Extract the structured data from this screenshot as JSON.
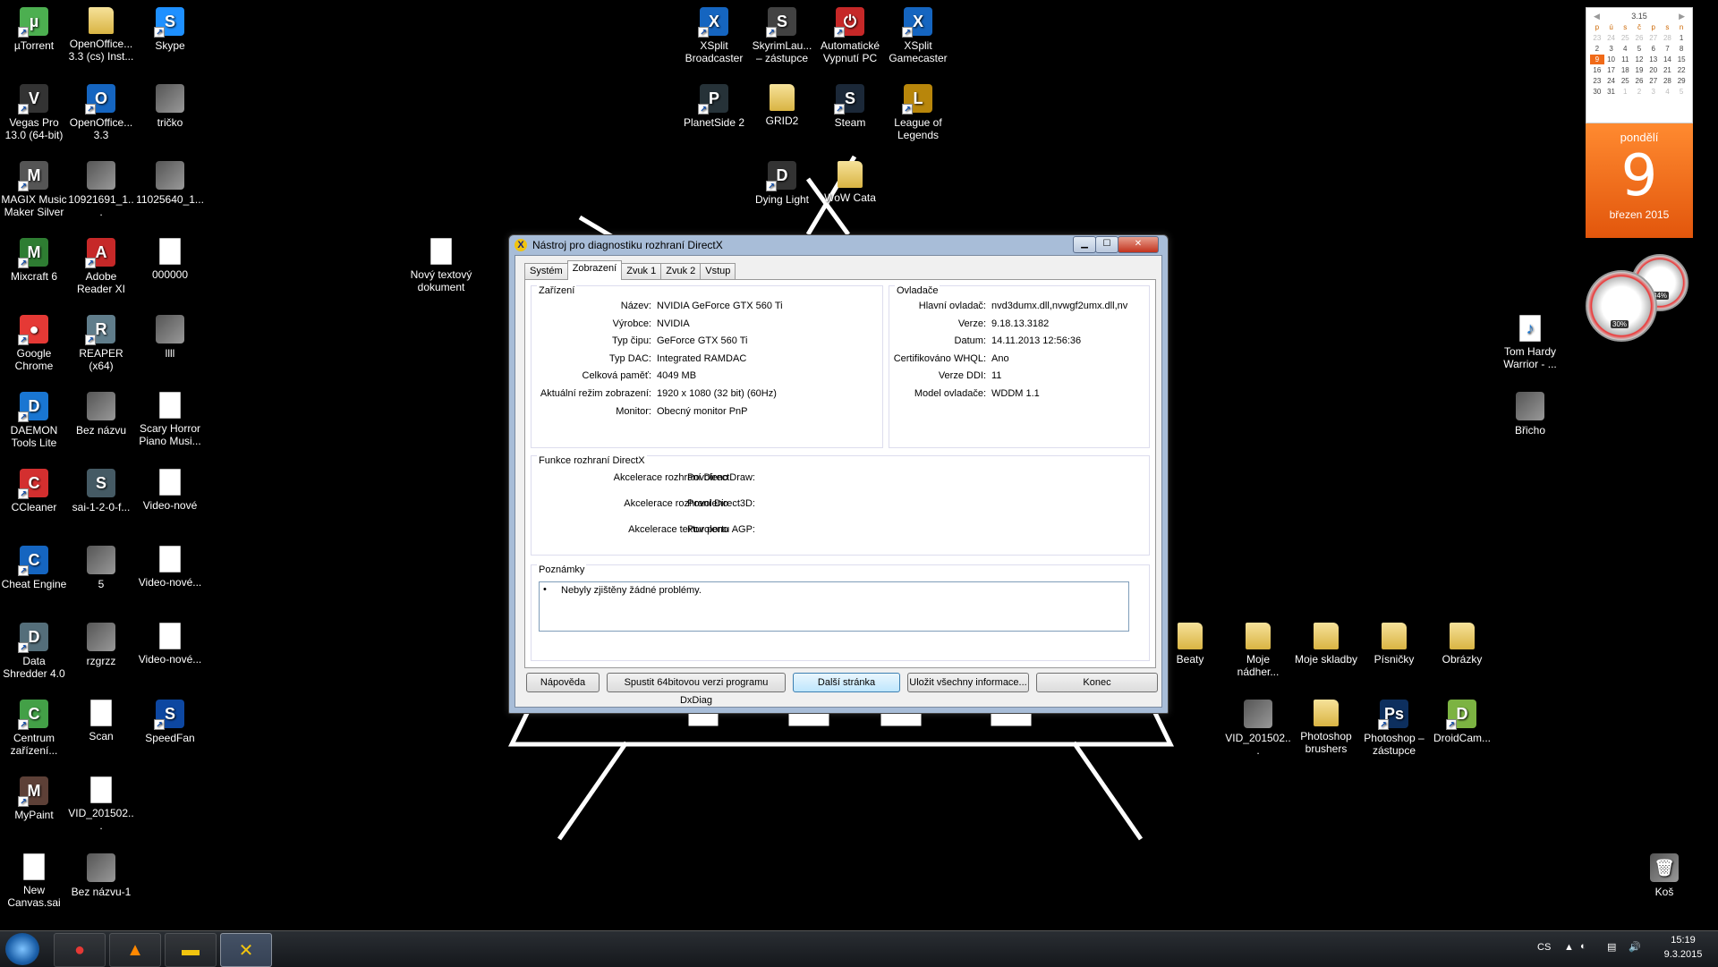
{
  "desktop": {
    "icons": [
      {
        "id": "utorrent",
        "label": "µTorrent",
        "color": "#4caf50",
        "glyph": "µ"
      },
      {
        "id": "openoffice-inst",
        "label": "OpenOffice... 3.3 (cs) Inst...",
        "color": "",
        "glyph": ""
      },
      {
        "id": "skype",
        "label": "Skype",
        "color": "#1e90ff",
        "glyph": "S"
      },
      {
        "id": "vegas",
        "label": "Vegas Pro 13.0 (64-bit)",
        "color": "#333",
        "glyph": "V"
      },
      {
        "id": "openoffice",
        "label": "OpenOffice... 3.3",
        "color": "#1565c0",
        "glyph": "O"
      },
      {
        "id": "tricko",
        "label": "tričko",
        "color": "",
        "glyph": ""
      },
      {
        "id": "magix",
        "label": "MAGIX Music Maker Silver",
        "color": "#555",
        "glyph": "M"
      },
      {
        "id": "img1",
        "label": "10921691_1...",
        "color": "",
        "glyph": ""
      },
      {
        "id": "img2",
        "label": "11025640_1...",
        "color": "",
        "glyph": ""
      },
      {
        "id": "mixcraft",
        "label": "Mixcraft 6",
        "color": "#2e7d32",
        "glyph": "M"
      },
      {
        "id": "adobe",
        "label": "Adobe Reader XI",
        "color": "#c62828",
        "glyph": "A"
      },
      {
        "id": "file000000",
        "label": "000000",
        "color": "",
        "glyph": ""
      },
      {
        "id": "chrome",
        "label": "Google Chrome",
        "color": "#e53935",
        "glyph": "●"
      },
      {
        "id": "reaper",
        "label": "REAPER (x64)",
        "color": "#607d8b",
        "glyph": "R"
      },
      {
        "id": "llll",
        "label": "llll",
        "color": "",
        "glyph": ""
      },
      {
        "id": "daemon",
        "label": "DAEMON Tools Lite",
        "color": "#1976d2",
        "glyph": "D"
      },
      {
        "id": "beznazvu",
        "label": "Bez názvu",
        "color": "",
        "glyph": ""
      },
      {
        "id": "scary",
        "label": "Scary Horror Piano Musi...",
        "color": "",
        "glyph": ""
      },
      {
        "id": "ccleaner",
        "label": "CCleaner",
        "color": "#d32f2f",
        "glyph": "C"
      },
      {
        "id": "sai",
        "label": "sai-1-2-0-f...",
        "color": "#455a64",
        "glyph": "S"
      },
      {
        "id": "video-nove",
        "label": "Video-nové",
        "color": "",
        "glyph": ""
      },
      {
        "id": "cheat",
        "label": "Cheat Engine",
        "color": "#1565c0",
        "glyph": "C"
      },
      {
        "id": "five",
        "label": "5",
        "color": "",
        "glyph": ""
      },
      {
        "id": "video-nove2",
        "label": "Video-nové...",
        "color": "",
        "glyph": ""
      },
      {
        "id": "shredder",
        "label": "Data Shredder 4.0",
        "color": "#546e7a",
        "glyph": "D"
      },
      {
        "id": "rzgrzz",
        "label": "rzgrzz",
        "color": "",
        "glyph": ""
      },
      {
        "id": "video-nove3",
        "label": "Video-nové...",
        "color": "",
        "glyph": ""
      },
      {
        "id": "centrum",
        "label": "Centrum zařízení...",
        "color": "#43a047",
        "glyph": "C"
      },
      {
        "id": "scan",
        "label": "Scan",
        "color": "",
        "glyph": ""
      },
      {
        "id": "speedfan",
        "label": "SpeedFan",
        "color": "#0d47a1",
        "glyph": "S"
      },
      {
        "id": "mypaint",
        "label": "MyPaint",
        "color": "#5d4037",
        "glyph": "M"
      },
      {
        "id": "vid2015a",
        "label": "VID_201502...",
        "color": "",
        "glyph": ""
      },
      {
        "id": "newcanvas",
        "label": "New Canvas.sai",
        "color": "",
        "glyph": ""
      },
      {
        "id": "beznazvu1",
        "label": "Bez názvu-1",
        "color": "",
        "glyph": ""
      },
      {
        "id": "textdoc",
        "label": "Nový textový dokument",
        "color": "",
        "glyph": ""
      },
      {
        "id": "xsplit-b",
        "label": "XSplit Broadcaster",
        "color": "#1565c0",
        "glyph": "X"
      },
      {
        "id": "skyrim",
        "label": "SkyrimLau... – zástupce",
        "color": "#424242",
        "glyph": "S"
      },
      {
        "id": "autooff",
        "label": "Automatické Vypnutí PC",
        "color": "#c62828",
        "glyph": "⏻"
      },
      {
        "id": "xsplit-g",
        "label": "XSplit Gamecaster",
        "color": "#1565c0",
        "glyph": "X"
      },
      {
        "id": "planetside",
        "label": "PlanetSide 2",
        "color": "#263238",
        "glyph": "P"
      },
      {
        "id": "grid2",
        "label": "GRID2",
        "color": "",
        "glyph": ""
      },
      {
        "id": "steam",
        "label": "Steam",
        "color": "#1b2838",
        "glyph": "S"
      },
      {
        "id": "lol",
        "label": "League of Legends",
        "color": "#b8860b",
        "glyph": "L"
      },
      {
        "id": "dyinglight",
        "label": "Dying Light",
        "color": "#333",
        "glyph": "D"
      },
      {
        "id": "wowcata",
        "label": "WoW Cata",
        "color": "",
        "glyph": ""
      },
      {
        "id": "tomhardy",
        "label": "Tom Hardy Warrior - ...",
        "color": "",
        "glyph": "♪"
      },
      {
        "id": "bricho",
        "label": "Břicho",
        "color": "",
        "glyph": ""
      },
      {
        "id": "beaty",
        "label": "Beaty",
        "color": "",
        "glyph": ""
      },
      {
        "id": "mojenadher",
        "label": "Moje nádher...",
        "color": "",
        "glyph": ""
      },
      {
        "id": "mojeskladby",
        "label": "Moje skladby",
        "color": "",
        "glyph": ""
      },
      {
        "id": "pisnicky",
        "label": "Písničky",
        "color": "",
        "glyph": ""
      },
      {
        "id": "obrazky",
        "label": "Obrázky",
        "color": "",
        "glyph": ""
      },
      {
        "id": "vid2015b",
        "label": "VID_201502...",
        "color": "",
        "glyph": ""
      },
      {
        "id": "psbrushes",
        "label": "Photoshop brushers",
        "color": "",
        "glyph": ""
      },
      {
        "id": "pszastupce",
        "label": "Photoshop – zástupce",
        "color": "#0d2f5e",
        "glyph": "Ps"
      },
      {
        "id": "droidcam",
        "label": "DroidCam...",
        "color": "#7cb342",
        "glyph": "D"
      },
      {
        "id": "kos",
        "label": "Koš",
        "color": "",
        "glyph": "🗑"
      }
    ]
  },
  "calendar": {
    "header": "3.15",
    "weekdays": [
      "p",
      "ú",
      "s",
      "č",
      "p",
      "s",
      "n"
    ],
    "days": [
      "23",
      "24",
      "25",
      "26",
      "27",
      "28",
      "1",
      "2",
      "3",
      "4",
      "5",
      "6",
      "7",
      "8",
      "9",
      "10",
      "11",
      "12",
      "13",
      "14",
      "15",
      "16",
      "17",
      "18",
      "19",
      "20",
      "21",
      "22",
      "23",
      "24",
      "25",
      "26",
      "27",
      "28",
      "29",
      "30",
      "31",
      "1",
      "2",
      "3",
      "4",
      "5"
    ],
    "today_index": 14,
    "weekday_name": "pondělí",
    "day_number": "9",
    "month_year": "březen 2015"
  },
  "gauges": {
    "cpu": "30%",
    "mem": "34%"
  },
  "dxdiag": {
    "title": "Nástroj pro diagnostiku rozhraní DirectX",
    "tabs": [
      "Systém",
      "Zobrazení",
      "Zvuk 1",
      "Zvuk 2",
      "Vstup"
    ],
    "active_tab": 1,
    "device_title": "Zařízení",
    "device": [
      {
        "k": "Název:",
        "v": "NVIDIA GeForce GTX 560 Ti"
      },
      {
        "k": "Výrobce:",
        "v": "NVIDIA"
      },
      {
        "k": "Typ čipu:",
        "v": "GeForce GTX 560 Ti"
      },
      {
        "k": "Typ DAC:",
        "v": "Integrated RAMDAC"
      },
      {
        "k": "Celková paměť:",
        "v": "4049 MB"
      },
      {
        "k": "Aktuální režim zobrazení:",
        "v": "1920 x 1080 (32 bit) (60Hz)"
      },
      {
        "k": "Monitor:",
        "v": "Obecný monitor PnP"
      }
    ],
    "drivers_title": "Ovladače",
    "drivers": [
      {
        "k": "Hlavní ovladač:",
        "v": "nvd3dumx.dll,nvwgf2umx.dll,nv"
      },
      {
        "k": "Verze:",
        "v": "9.18.13.3182"
      },
      {
        "k": "Datum:",
        "v": "14.11.2013 12:56:36"
      },
      {
        "k": "Certifikováno WHQL:",
        "v": "Ano"
      },
      {
        "k": "Verze DDI:",
        "v": "11"
      },
      {
        "k": "Model ovladače:",
        "v": "WDDM 1.1"
      }
    ],
    "features_title": "Funkce rozhraní DirectX",
    "features": [
      {
        "k": "Akcelerace rozhraní DirectDraw:",
        "v": "Povoleno"
      },
      {
        "k": "Akcelerace rozhraní Direct3D:",
        "v": "Povoleno"
      },
      {
        "k": "Akcelerace textur portu AGP:",
        "v": "Povoleno"
      }
    ],
    "notes_title": "Poznámky",
    "notes": "Nebyly zjištěny žádné problémy.",
    "buttons": {
      "help": "Nápověda",
      "run64": "Spustit 64bitovou verzi programu DxDiag",
      "next": "Další stránka",
      "save": "Uložit všechny informace...",
      "exit": "Konec"
    }
  },
  "taskbar": {
    "lang": "CS",
    "time": "15:19",
    "date": "9.3.2015"
  }
}
